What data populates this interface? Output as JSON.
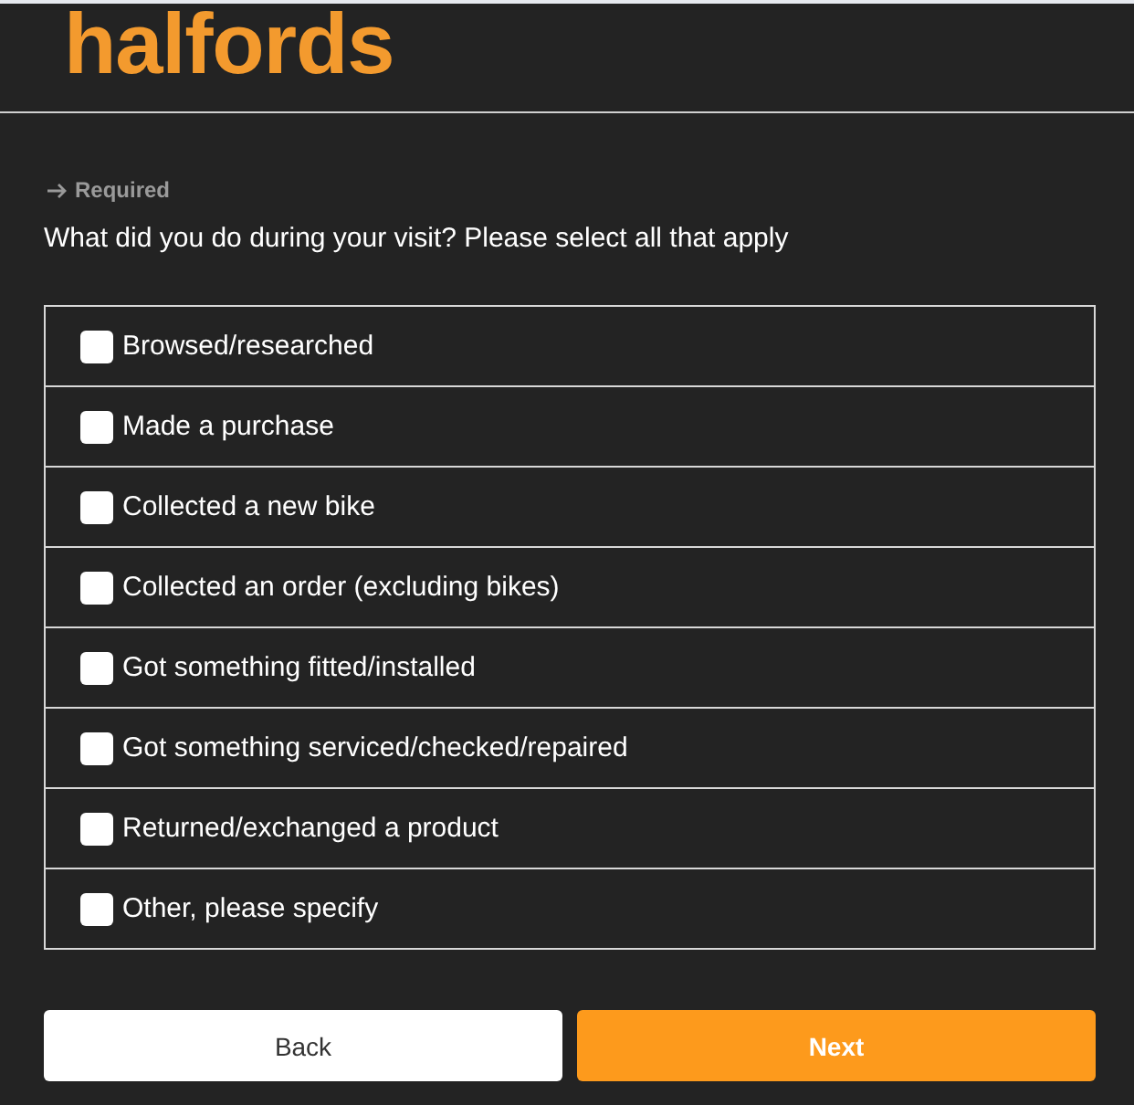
{
  "header": {
    "logo": "halfords"
  },
  "question": {
    "required_label": "Required",
    "text": "What did you do during your visit? Please select all that apply"
  },
  "options": [
    {
      "label": "Browsed/researched",
      "checked": false
    },
    {
      "label": "Made a purchase",
      "checked": false
    },
    {
      "label": "Collected a new bike",
      "checked": false
    },
    {
      "label": "Collected an order (excluding bikes)",
      "checked": false
    },
    {
      "label": "Got something fitted/installed",
      "checked": false
    },
    {
      "label": "Got something serviced/checked/repaired",
      "checked": false
    },
    {
      "label": "Returned/exchanged a product",
      "checked": false
    },
    {
      "label": "Other, please specify",
      "checked": false
    }
  ],
  "buttons": [
    {
      "label": "Back",
      "kind": "secondary"
    },
    {
      "label": "Next",
      "kind": "primary"
    }
  ]
}
